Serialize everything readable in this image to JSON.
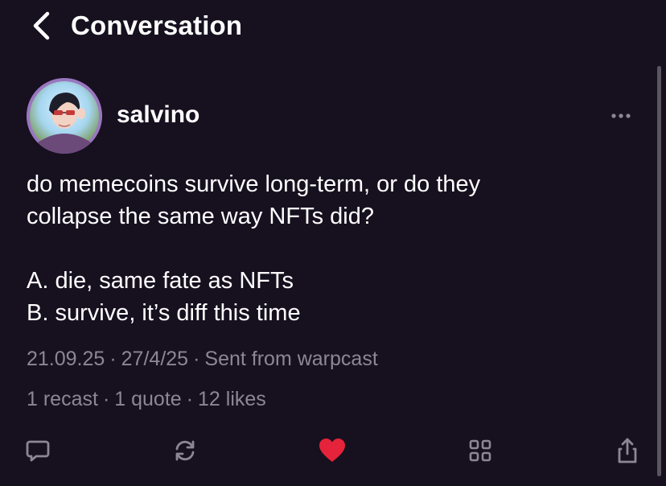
{
  "header": {
    "title": "Conversation"
  },
  "post": {
    "username": "salvino",
    "text_lines": [
      "do memecoins survive long-term, or do they",
      "collapse the same way NFTs did?",
      "",
      "A. die, same fate as NFTs",
      "B. survive, it’s diff this time"
    ],
    "meta": {
      "date": "21.09.25",
      "secondary_date": "27/4/25",
      "source": "Sent from warpcast"
    },
    "stats": {
      "recasts": "1 recast",
      "quotes": "1 quote",
      "likes": "12 likes"
    }
  },
  "icons": {
    "back": "chevron-left-icon",
    "more": "ellipsis-icon",
    "reply": "speech-bubble-icon",
    "recast": "refresh-arrows-icon",
    "like": "heart-icon",
    "apps": "grid-icon",
    "share": "share-icon"
  },
  "colors": {
    "background": "#17101f",
    "text": "#ffffff",
    "muted": "#8d8793",
    "like": "#e5233a"
  },
  "separator": "·"
}
